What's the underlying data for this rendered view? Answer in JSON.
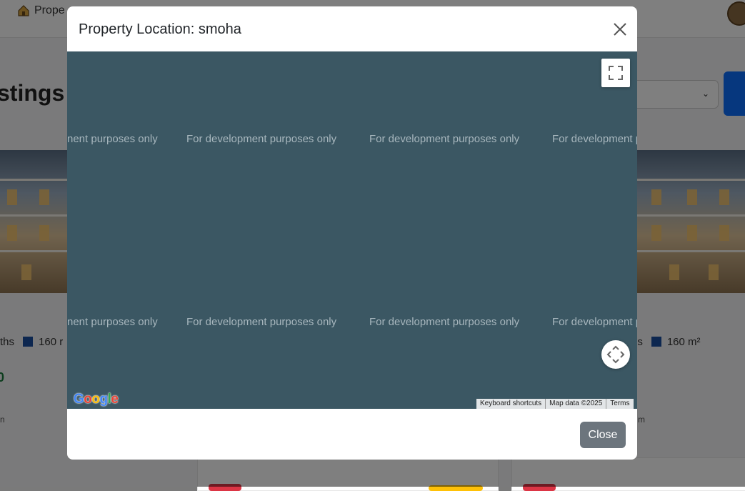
{
  "background": {
    "brand_label": "Prope",
    "heading": "stings",
    "card_left": {
      "baths_text": "ths",
      "area_text": "160 r",
      "price_fragment": "0",
      "small_fragment": "n"
    },
    "card_right": {
      "baths_text": "ns",
      "area_text": "160 m²",
      "small_fragment": "m"
    }
  },
  "modal": {
    "title": "Property Location: smoha",
    "close_icon": "close-icon",
    "map": {
      "watermark_text": "For development purposes only",
      "watermark_left_fragment": "nent purposes only",
      "watermark_right_fragment": "For development p",
      "fullscreen_icon": "fullscreen-icon",
      "camera_control_icon": "camera-control-icon",
      "google_logo_letters": [
        "G",
        "o",
        "o",
        "g",
        "l",
        "e"
      ],
      "google_logo_colors": [
        "#4285F4",
        "#EA4335",
        "#FBBC05",
        "#4285F4",
        "#34A853",
        "#EA4335"
      ],
      "attribution": {
        "keyboard_shortcuts": "Keyboard shortcuts",
        "map_data": "Map data ©2025",
        "terms": "Terms"
      },
      "background_color": "#3b5763"
    },
    "footer": {
      "close_label": "Close"
    }
  },
  "colors": {
    "close_button": "#6c757d",
    "primary": "#0d6efd",
    "price_green": "#1a7a3c"
  }
}
